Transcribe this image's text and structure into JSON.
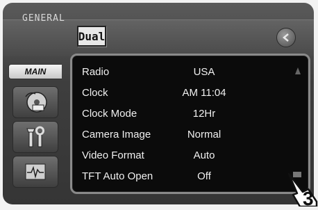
{
  "header": {
    "section_title": "GENERAL",
    "logo_text": "Dual"
  },
  "sidebar": {
    "main_tab_label": "MAIN",
    "items": [
      {
        "icon": "disc-dvd-icon"
      },
      {
        "icon": "tools-icon"
      },
      {
        "icon": "waveform-icon"
      }
    ]
  },
  "settings": [
    {
      "label": "Radio",
      "value": "USA"
    },
    {
      "label": "Clock",
      "value": "AM 11:04"
    },
    {
      "label": "Clock Mode",
      "value": "12Hr"
    },
    {
      "label": "Camera Image",
      "value": "Normal"
    },
    {
      "label": "Video Format",
      "value": "Auto"
    },
    {
      "label": "TFT Auto Open",
      "value": "Off"
    }
  ],
  "callout": {
    "step_number": "3"
  },
  "colors": {
    "panel_bg": "#0b0b0b",
    "bezel": "#3e3e3e",
    "text": "#f0f0f0"
  }
}
